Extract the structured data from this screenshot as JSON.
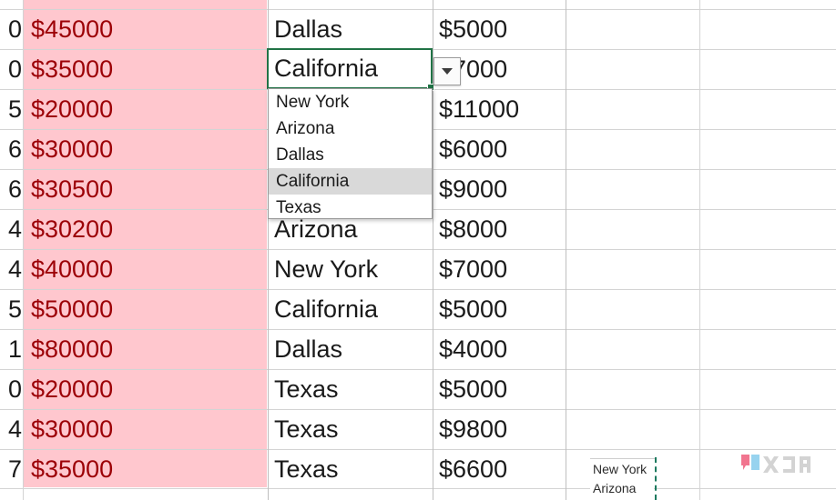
{
  "app": {
    "context": "spreadsheet-data-validation-dropdown",
    "accent_green": "#217346",
    "fill_pink": "#ffc7ce",
    "text_red": "#9c0006",
    "gridline": "#d4d4d4",
    "highlight_gray": "#d9d9d9"
  },
  "columns": {
    "num_fragment_header": "",
    "amount_header": "",
    "state_header": "",
    "value_header": ""
  },
  "rows": [
    {
      "num_fragment": "0",
      "amount": "$45000",
      "state": "Dallas",
      "value": "$5000"
    },
    {
      "num_fragment": "0",
      "amount": "$35000",
      "state": "California",
      "value": "$7000"
    },
    {
      "num_fragment": "5",
      "amount": "$20000",
      "state": "",
      "value": "$11000"
    },
    {
      "num_fragment": "6",
      "amount": "$30000",
      "state": "",
      "value": "$6000"
    },
    {
      "num_fragment": "6",
      "amount": "$30500",
      "state": "",
      "value": "$9000"
    },
    {
      "num_fragment": "4",
      "amount": "$30200",
      "state": "Arizona",
      "value": "$8000"
    },
    {
      "num_fragment": "4",
      "amount": "$40000",
      "state": "New York",
      "value": "$7000"
    },
    {
      "num_fragment": "5",
      "amount": "$50000",
      "state": "California",
      "value": "$5000"
    },
    {
      "num_fragment": "1",
      "amount": "$80000",
      "state": "Dallas",
      "value": "$4000"
    },
    {
      "num_fragment": "0",
      "amount": "$20000",
      "state": "Texas",
      "value": "$5000"
    },
    {
      "num_fragment": "4",
      "amount": "$30000",
      "state": "Texas",
      "value": "$9800"
    },
    {
      "num_fragment": "7",
      "amount": "$35000",
      "state": "Texas",
      "value": "$6600"
    }
  ],
  "active_cell": {
    "value": "California",
    "dropdown_button_icon": "chevron-down-icon"
  },
  "dropdown": {
    "selected": "California",
    "options": [
      {
        "label": "New York",
        "selected": false
      },
      {
        "label": "Arizona",
        "selected": false
      },
      {
        "label": "Dallas",
        "selected": false
      },
      {
        "label": "California",
        "selected": true
      },
      {
        "label": "Texas",
        "selected": false
      }
    ]
  },
  "source_range": {
    "items": [
      {
        "label": "New York"
      },
      {
        "label": "Arizona"
      }
    ]
  },
  "watermark": {
    "text": "XDA"
  }
}
